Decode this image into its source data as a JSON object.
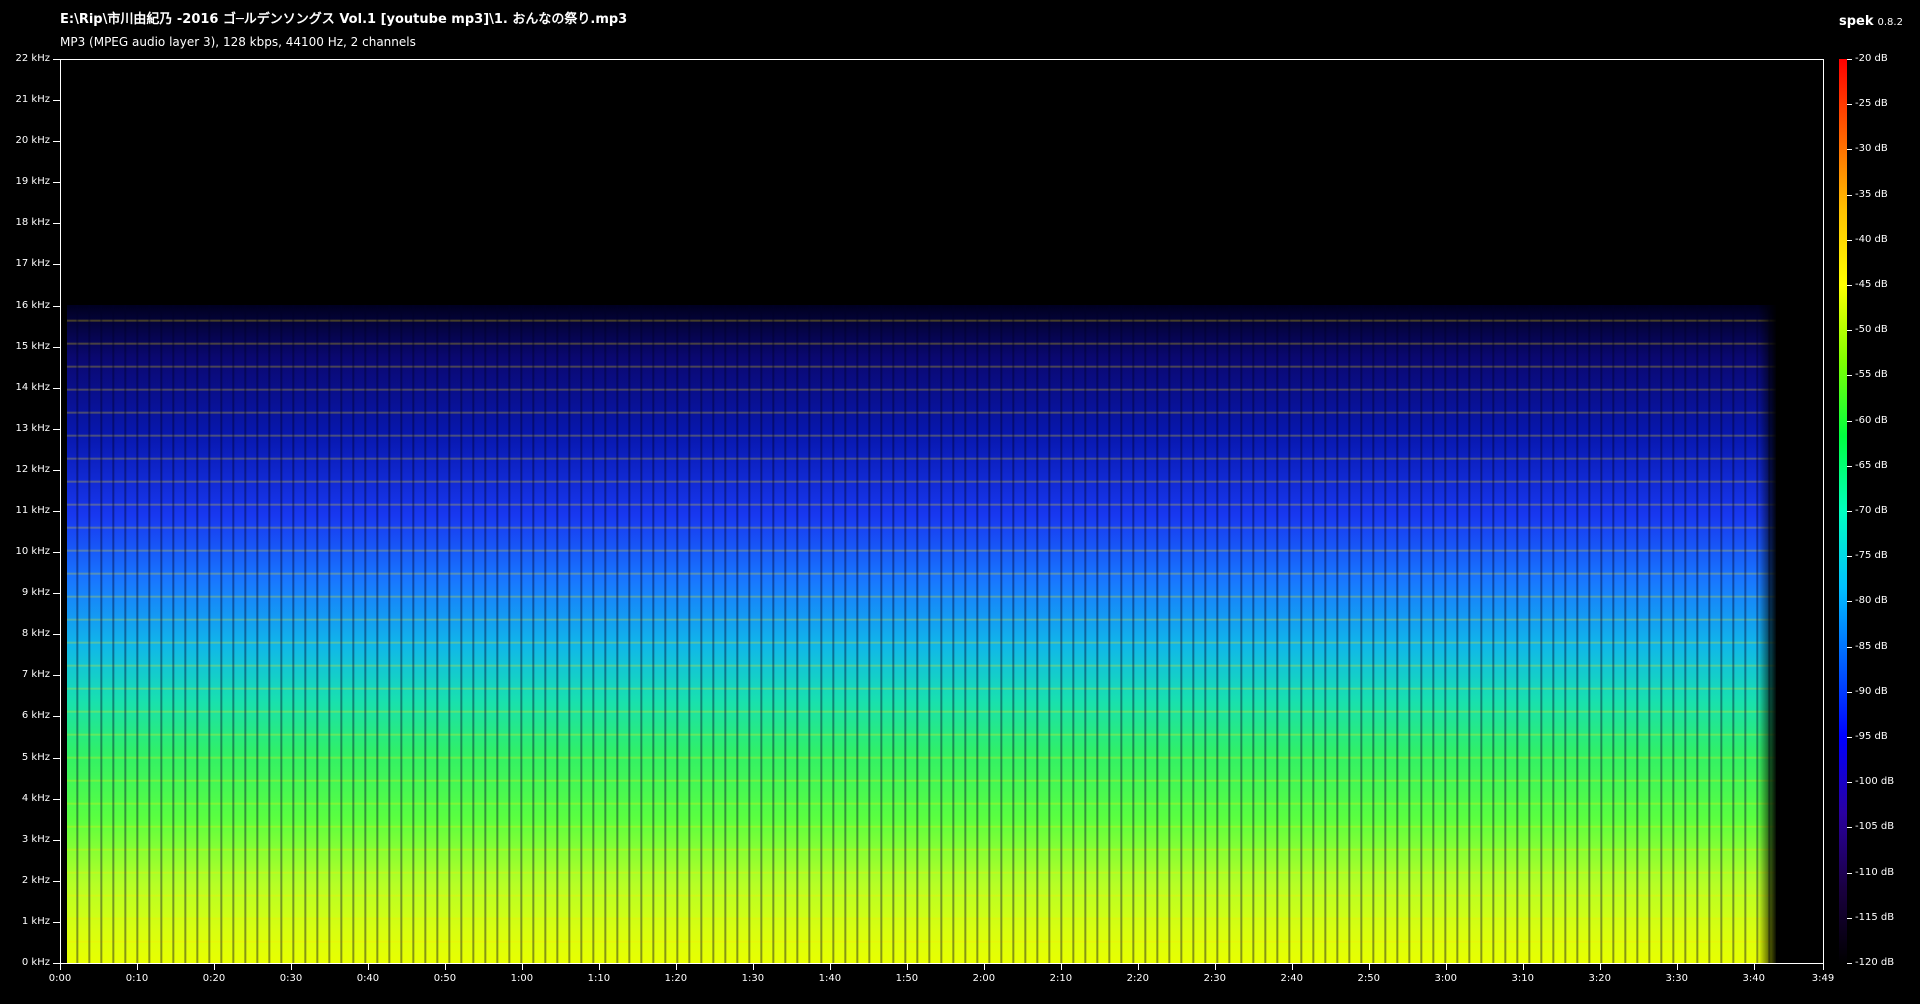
{
  "header": {
    "file_path": "E:\\Rip\\市川由紀乃 -2016 ゴ─ルデンソングス Vol.1 [youtube mp3]\\1. おんなの祭り.mp3",
    "file_info": "MP3 (MPEG audio layer 3), 128 kbps, 44100 Hz, 2 channels",
    "app_name": "spek",
    "app_version": "0.8.2"
  },
  "colors": {
    "background": "#000000",
    "text": "#ffffff",
    "axis": "#ffffff"
  },
  "colorbar_stops": [
    "#000000",
    "#1a0040",
    "#2a00a0",
    "#0000ff",
    "#0060ff",
    "#00c0ff",
    "#00ffc0",
    "#00ff40",
    "#80ff00",
    "#ffff00",
    "#ffc000",
    "#ff6000",
    "#ff0000"
  ],
  "chart_data": {
    "type": "heatmap",
    "y_axis": {
      "unit": "kHz",
      "range": [
        0,
        22
      ],
      "ticks": [
        "0 kHz",
        "1 kHz",
        "2 kHz",
        "3 kHz",
        "4 kHz",
        "5 kHz",
        "6 kHz",
        "7 kHz",
        "8 kHz",
        "9 kHz",
        "10 kHz",
        "11 kHz",
        "12 kHz",
        "13 kHz",
        "14 kHz",
        "15 kHz",
        "16 kHz",
        "17 kHz",
        "18 kHz",
        "19 kHz",
        "20 kHz",
        "21 kHz",
        "22 kHz"
      ]
    },
    "x_axis": {
      "unit": "time",
      "range_seconds": [
        0,
        229
      ],
      "ticks": [
        {
          "label": "0:00",
          "seconds": 0
        },
        {
          "label": "0:10",
          "seconds": 10
        },
        {
          "label": "0:20",
          "seconds": 20
        },
        {
          "label": "0:30",
          "seconds": 30
        },
        {
          "label": "0:40",
          "seconds": 40
        },
        {
          "label": "0:50",
          "seconds": 50
        },
        {
          "label": "1:00",
          "seconds": 60
        },
        {
          "label": "1:10",
          "seconds": 70
        },
        {
          "label": "1:20",
          "seconds": 80
        },
        {
          "label": "1:30",
          "seconds": 90
        },
        {
          "label": "1:40",
          "seconds": 100
        },
        {
          "label": "1:50",
          "seconds": 110
        },
        {
          "label": "2:00",
          "seconds": 120
        },
        {
          "label": "2:10",
          "seconds": 130
        },
        {
          "label": "2:20",
          "seconds": 140
        },
        {
          "label": "2:30",
          "seconds": 150
        },
        {
          "label": "2:40",
          "seconds": 160
        },
        {
          "label": "2:50",
          "seconds": 170
        },
        {
          "label": "3:00",
          "seconds": 180
        },
        {
          "label": "3:10",
          "seconds": 190
        },
        {
          "label": "3:20",
          "seconds": 200
        },
        {
          "label": "3:30",
          "seconds": 210
        },
        {
          "label": "3:40",
          "seconds": 220
        },
        {
          "label": "3:49",
          "seconds": 229
        }
      ]
    },
    "color_scale": {
      "unit": "dB",
      "range": [
        -120,
        -20
      ],
      "ticks": [
        "-20 dB",
        "-25 dB",
        "-30 dB",
        "-35 dB",
        "-40 dB",
        "-45 dB",
        "-50 dB",
        "-55 dB",
        "-60 dB",
        "-65 dB",
        "-70 dB",
        "-75 dB",
        "-80 dB",
        "-85 dB",
        "-90 dB",
        "-95 dB",
        "-100 dB",
        "-105 dB",
        "-110 dB",
        "-115 dB",
        "-120 dB"
      ]
    },
    "spectral_cutoff_khz": 16
  }
}
